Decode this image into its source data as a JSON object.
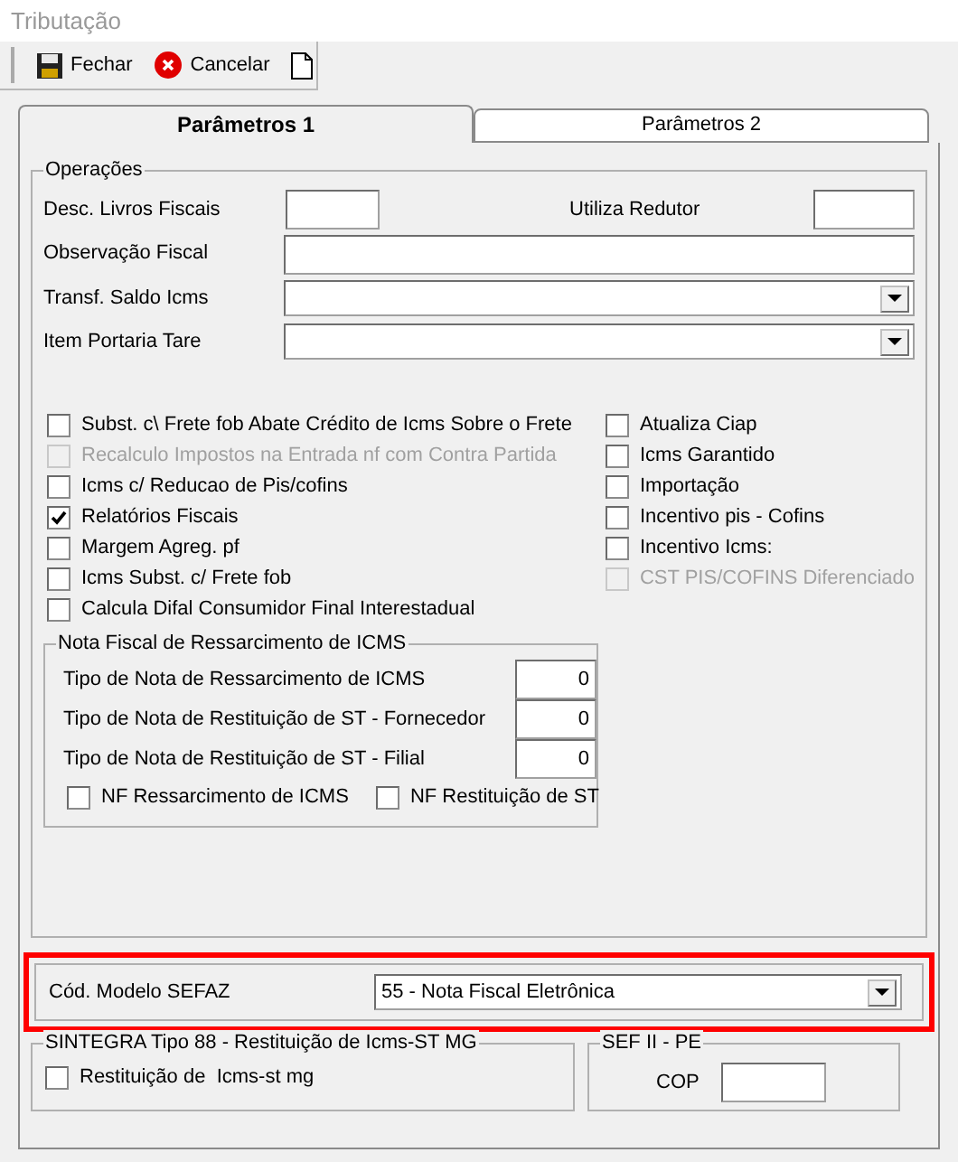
{
  "window": {
    "title": "Tributação"
  },
  "toolbar": [
    {
      "kind": "save",
      "label": "Fechar"
    },
    {
      "kind": "cancel",
      "label": "Cancelar"
    },
    {
      "kind": "new"
    }
  ],
  "tabs": [
    {
      "label": "Parâmetros 1",
      "selected": true
    },
    {
      "label": "Parâmetros 2",
      "selected": false
    }
  ],
  "operacoes": {
    "title": "Operações",
    "desc_livros": "Desc. Livros Fiscais",
    "utiliza_redutor": "Utiliza Redutor",
    "observacao": "Observação Fiscal",
    "transf_saldo": "Transf. Saldo Icms",
    "item_portaria": "Item Portaria Tare",
    "checks_left": [
      {
        "label": "Subst. c\\ Frete fob Abate Crédito de Icms Sobre o Frete",
        "checked": false,
        "disabled": false
      },
      {
        "label": "Recalculo Impostos na Entrada nf com Contra Partida",
        "checked": false,
        "disabled": true
      },
      {
        "label": "Icms c/ Reducao de Pis/cofins",
        "checked": false,
        "disabled": false
      },
      {
        "label": "Relatórios Fiscais",
        "checked": true,
        "disabled": false
      },
      {
        "label": "Margem Agreg. pf",
        "checked": false,
        "disabled": false
      },
      {
        "label": "Icms Subst. c/ Frete fob",
        "checked": false,
        "disabled": false
      },
      {
        "label": "Calcula Difal Consumidor Final Interestadual",
        "checked": false,
        "disabled": false
      }
    ],
    "checks_right": [
      {
        "label": "Atualiza Ciap",
        "checked": false,
        "disabled": false
      },
      {
        "label": "Icms Garantido",
        "checked": false,
        "disabled": false
      },
      {
        "label": "Importação",
        "checked": false,
        "disabled": false
      },
      {
        "label": "Incentivo pis - Cofins",
        "checked": false,
        "disabled": false
      },
      {
        "label": "Incentivo Icms:",
        "checked": false,
        "disabled": false
      },
      {
        "label": "CST PIS/COFINS Diferenciado",
        "checked": false,
        "disabled": true
      }
    ]
  },
  "nota_fiscal": {
    "title": "Nota Fiscal de Ressarcimento de ICMS",
    "rows": [
      {
        "label": "Tipo de Nota de Ressarcimento de ICMS",
        "value": "0"
      },
      {
        "label": "Tipo de Nota de Restituição de ST - Fornecedor",
        "value": "0"
      },
      {
        "label": "Tipo de Nota de Restituição de ST - Filial",
        "value": "0"
      }
    ],
    "checks": [
      {
        "label": "NF Ressarcimento de ICMS",
        "checked": false
      },
      {
        "label": "NF Restituição de ST",
        "checked": false
      }
    ]
  },
  "sefaz": {
    "label": "Cód. Modelo SEFAZ",
    "value": "55 - Nota Fiscal Eletrônica",
    "highlighted": true
  },
  "sintegra": {
    "title": "SINTEGRA Tipo 88 - Restituição de Icms-ST MG",
    "check": {
      "label": "Restituição de  Icms-st mg",
      "checked": false
    }
  },
  "sef": {
    "title": "SEF II - PE",
    "cop_label": "COP"
  }
}
